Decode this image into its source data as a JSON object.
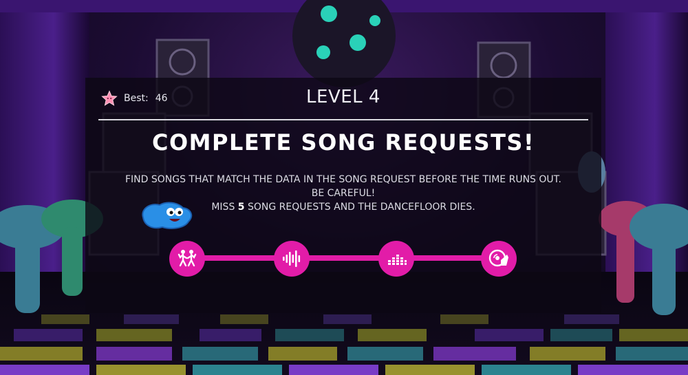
{
  "header": {
    "best_label": "Best:",
    "best_value": "46",
    "level_title": "LEVEL 4"
  },
  "objective": {
    "headline": "COMPLETE SONG REQUESTS!",
    "line1": "FIND SONGS THAT MATCH THE DATA IN THE SONG REQUEST BEFORE THE TIME RUNS OUT.",
    "line2": "BE CAREFUL!",
    "line3_prefix": "MISS ",
    "line3_count": "5",
    "line3_suffix": " SONG REQUESTS AND THE DANCEFLOOR DIES."
  },
  "progress": {
    "steps": [
      {
        "icon": "dancers-icon"
      },
      {
        "icon": "soundwave-icon"
      },
      {
        "icon": "equalizer-icon"
      },
      {
        "icon": "dj-turntable-icon"
      }
    ]
  },
  "colors": {
    "accent": "#e21ca8",
    "panel": "#0c0814",
    "text": "#ffffff"
  }
}
